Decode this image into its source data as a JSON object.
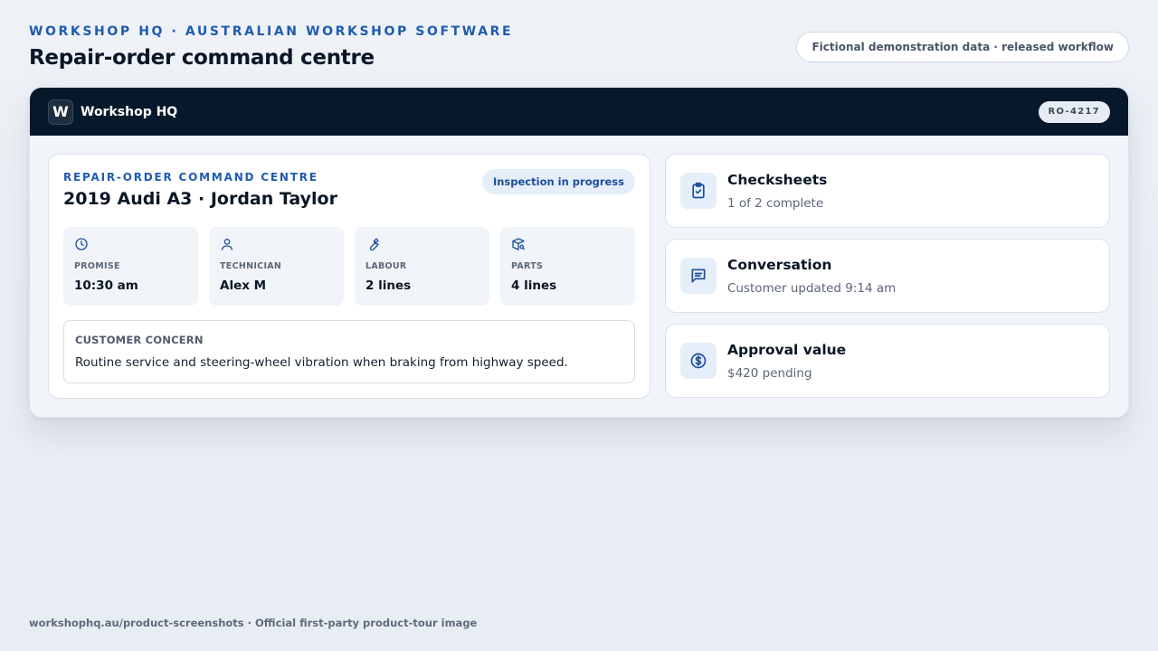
{
  "header": {
    "eyebrow": "WORKSHOP HQ · AUSTRALIAN WORKSHOP SOFTWARE",
    "title": "Repair-order command centre",
    "demo_note": "Fictional demonstration data · released workflow"
  },
  "app": {
    "logo_letter": "W",
    "name": "Workshop HQ",
    "ro_number": "RO-4217"
  },
  "main": {
    "eyebrow": "REPAIR-ORDER COMMAND CENTRE",
    "vehicle_title": "2019 Audi A3 · Jordan Taylor",
    "status": "Inspection in progress",
    "tiles": [
      {
        "icon": "clock-icon",
        "label": "PROMISE",
        "value": "10:30 am"
      },
      {
        "icon": "user-icon",
        "label": "TECHNICIAN",
        "value": "Alex M"
      },
      {
        "icon": "wrench-icon",
        "label": "LABOUR",
        "value": "2 lines"
      },
      {
        "icon": "package-icon",
        "label": "PARTS",
        "value": "4 lines"
      }
    ],
    "concern": {
      "label": "CUSTOMER CONCERN",
      "text": "Routine service and steering-wheel vibration when braking from highway speed."
    }
  },
  "side": [
    {
      "icon": "clipboard-check-icon",
      "title": "Checksheets",
      "subtitle": "1 of 2 complete"
    },
    {
      "icon": "message-icon",
      "title": "Conversation",
      "subtitle": "Customer updated 9:14 am"
    },
    {
      "icon": "dollar-icon",
      "title": "Approval value",
      "subtitle": "$420 pending"
    }
  ],
  "footer": "workshophq.au/product-screenshots · Official first-party product-tour image",
  "colors": {
    "accent": "#1f5bb0",
    "app_bar": "#07182a",
    "icon_stroke": "#1c4f9c"
  }
}
